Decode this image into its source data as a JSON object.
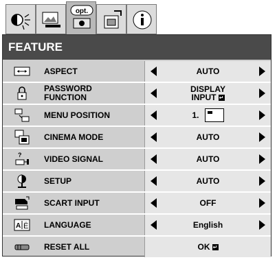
{
  "tabs": [
    {
      "name": "picture-adjust-tab-icon",
      "active": false,
      "label": ""
    },
    {
      "name": "image-tab-icon",
      "active": false,
      "label": ""
    },
    {
      "name": "opt-tab-icon",
      "active": true,
      "label": "opt."
    },
    {
      "name": "installation-tab-icon",
      "active": false,
      "label": ""
    },
    {
      "name": "info-tab-icon",
      "active": false,
      "label": ""
    }
  ],
  "menu": {
    "title": "FEATURE",
    "rows": [
      {
        "label": "ASPECT",
        "value": "AUTO",
        "icon": "aspect-icon"
      },
      {
        "label_line1": "PASSWORD",
        "label_line2": "FUNCTION",
        "value_line1": "DISPLAY",
        "value_line2": "INPUT",
        "icon": "padlock-icon"
      },
      {
        "label": "MENU POSITION",
        "value": "1.",
        "icon": "menu-position-icon"
      },
      {
        "label": "CINEMA MODE",
        "value": "AUTO",
        "icon": "cinema-mode-icon"
      },
      {
        "label": "VIDEO SIGNAL",
        "value": "AUTO",
        "icon": "video-signal-icon"
      },
      {
        "label": "SETUP",
        "value": "AUTO",
        "icon": "setup-icon"
      },
      {
        "label": "SCART INPUT",
        "value": "OFF",
        "icon": "scart-input-icon"
      },
      {
        "label": "LANGUAGE",
        "value": "English",
        "icon": "language-icon"
      },
      {
        "label": "RESET ALL",
        "value": "OK",
        "icon": "reset-all-icon"
      }
    ]
  },
  "colors": {
    "titlebar": "#4a4a4a",
    "panel": "#cfcfcf",
    "value_cell": "#e6e6e6"
  }
}
